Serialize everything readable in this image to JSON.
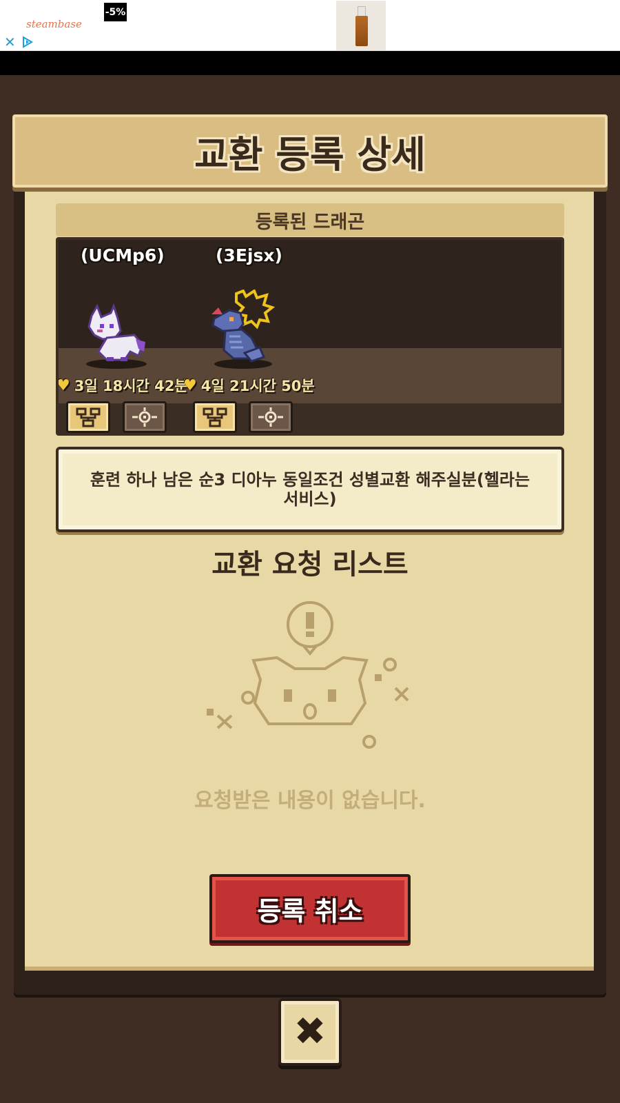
{
  "ad": {
    "brand": "steambase",
    "discount": "-5%"
  },
  "dialog": {
    "title": "교환 등록 상세",
    "section_label": "등록된 드래곤",
    "dragons": [
      {
        "name": "(UCMp6)",
        "timer": "3일 18시간 42분"
      },
      {
        "name": "(3Ejsx)",
        "timer": "4일 21시간 50분"
      }
    ],
    "description": "훈련 하나 남은 순3 디아누 동일조건 성별교환 해주실분(헬라는 서비스)",
    "request_list_title": "교환 요청 리스트",
    "empty_message": "요청받은 내용이 없습니다.",
    "cancel_button": "등록 취소",
    "close_button": "✖"
  }
}
